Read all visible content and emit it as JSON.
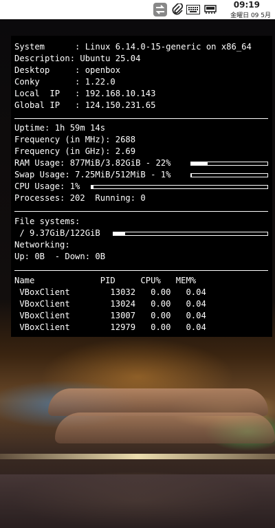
{
  "panel": {
    "time": "09:19",
    "date": "金曜日 09 5月",
    "tray_icons": [
      "network-transfer-icon",
      "paperclip-icon",
      "keyboard-icon",
      "network-card-icon"
    ]
  },
  "conky": {
    "system": {
      "system": "System      : Linux 6.14.0-15-generic on x86_64",
      "description": "Description: Ubuntu 25.04",
      "desktop": "Desktop     : openbox",
      "conky": "Conky       : 1.22.0",
      "local_ip": "Local  IP   : 192.168.10.143",
      "global_ip": "Global IP   : 124.150.231.65"
    },
    "stats": {
      "uptime": "Uptime: 1h 59m 14s",
      "freq_mhz": "Frequency (in MHz): 2688",
      "freq_ghz": "Frequency (in GHz): 2.69",
      "ram": "RAM Usage: 877MiB/3.82GiB - 22%",
      "ram_fraction": 0.22,
      "swap": "Swap Usage: 7.25MiB/512MiB - 1%",
      "swap_fraction": 0.01,
      "cpu": "CPU Usage: 1%",
      "cpu_fraction": 0.01,
      "processes": "Processes: 202  Running: 0"
    },
    "fs": {
      "header": "File systems:",
      "root": " / 9.37GiB/122GiB",
      "root_fraction": 0.077,
      "networking": "Networking:",
      "net": "Up: 0B  - Down: 0B"
    },
    "processes": {
      "header": "Name             PID     CPU%   MEM%",
      "rows": [
        " VBoxClient        13032   0.00   0.04",
        " VBoxClient        13024   0.00   0.04",
        " VBoxClient        13007   0.00   0.04",
        " VBoxClient        12979   0.00   0.04"
      ]
    }
  }
}
